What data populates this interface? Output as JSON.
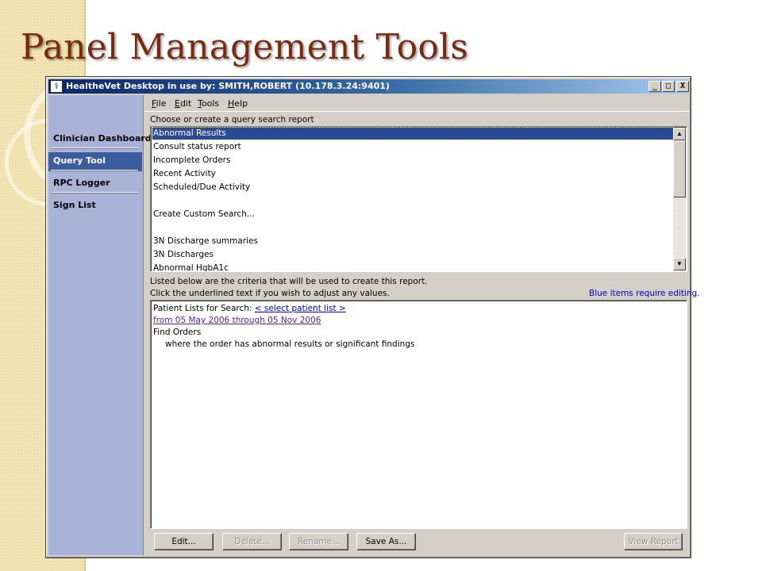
{
  "slide": {
    "title": "Panel Management Tools"
  },
  "window": {
    "title": "HealtheVet Desktop in use by: SMITH,ROBERT  (10.178.3.24:9401)",
    "controls": {
      "minimize": "_",
      "maximize": "□",
      "close": "X"
    }
  },
  "sidebar": {
    "items": [
      {
        "label": "Clinician Dashboard",
        "active": false
      },
      {
        "label": "Query Tool",
        "active": true
      },
      {
        "label": "RPC Logger",
        "active": false
      },
      {
        "label": "Sign List",
        "active": false
      }
    ]
  },
  "menu": {
    "file": {
      "accel": "F",
      "rest": "ile"
    },
    "edit": {
      "accel": "E",
      "rest": "dit"
    },
    "tools": {
      "accel": "T",
      "rest": "ools"
    },
    "help": {
      "accel": "H",
      "rest": "elp"
    }
  },
  "query": {
    "heading": "Choose or create a query search report",
    "items": [
      "Abnormal Results",
      "Consult status report",
      "Incomplete Orders",
      "Recent Activity",
      "Scheduled/Due Activity",
      "",
      "Create Custom Search...",
      "",
      "3N Discharge summaries",
      "3N Discharges",
      "Abnormal HgbA1c"
    ],
    "selected_index": 0
  },
  "criteria": {
    "line1": "Listed below are the criteria that will be used to create this report.",
    "line2": "Click the underlined text if you wish to adjust any values.",
    "blue_note": "Blue items require editing.",
    "patient_lists_label": "Patient Lists for Search: ",
    "patient_list_link": "< select patient list >",
    "date_range": "from 05 May 2006 through 05 Nov 2006",
    "find": "Find Orders",
    "condition": "where the order has abnormal results or significant findings"
  },
  "buttons": {
    "edit": "Edit...",
    "delete": "Delete...",
    "rename": "Rename...",
    "save_as": "Save As...",
    "view_report": "View Report"
  },
  "colors": {
    "title": "#7a2a10",
    "sidebar_bg": "#a9b3d8",
    "selection": "#2a4a93",
    "link_blue": "#0000cc",
    "link_visited": "#6a1a9a"
  }
}
